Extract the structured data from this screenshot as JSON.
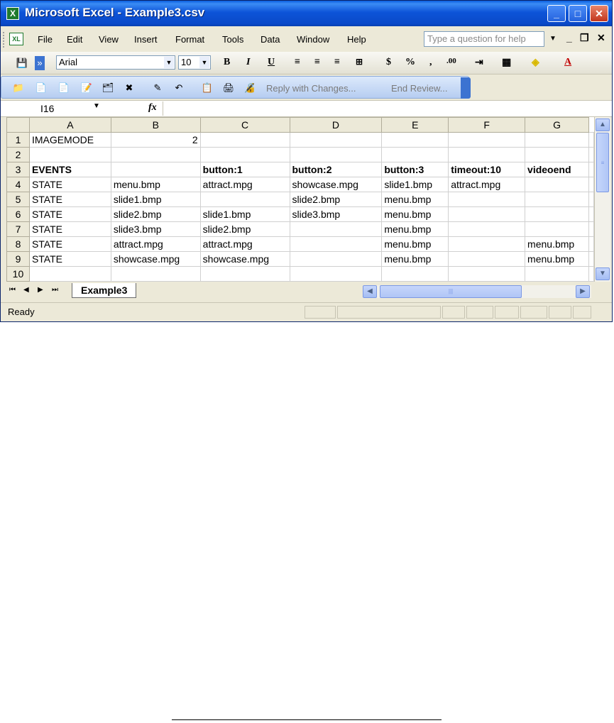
{
  "window": {
    "title": "Microsoft Excel - Example3.csv"
  },
  "menubar": {
    "items": [
      "File",
      "Edit",
      "View",
      "Insert",
      "Format",
      "Tools",
      "Data",
      "Window",
      "Help"
    ],
    "help_placeholder": "Type a question for help"
  },
  "formatting": {
    "font": "Arial",
    "size": "10",
    "bold": "B",
    "italic": "I",
    "underline": "U",
    "currency": "$",
    "percent": "%",
    "comma": ",",
    "decimal": ".00"
  },
  "reviewing": {
    "reply": "Reply with Changes...",
    "end": "End Review..."
  },
  "formula_bar": {
    "name_box": "I16",
    "fx": "fx",
    "value": ""
  },
  "sheet": {
    "columns": [
      "A",
      "B",
      "C",
      "D",
      "E",
      "F",
      "G"
    ],
    "rows": [
      {
        "n": "1",
        "cells": [
          "IMAGEMODE",
          "2",
          "",
          "",
          "",
          "",
          ""
        ]
      },
      {
        "n": "2",
        "cells": [
          "",
          "",
          "",
          "",
          "",
          "",
          ""
        ]
      },
      {
        "n": "3",
        "cells": [
          "EVENTS",
          "",
          "button:1",
          "button:2",
          "button:3",
          "timeout:10",
          "videoend"
        ]
      },
      {
        "n": "4",
        "cells": [
          "STATE",
          "menu.bmp",
          "attract.mpg",
          "showcase.mpg",
          "slide1.bmp",
          "attract.mpg",
          ""
        ]
      },
      {
        "n": "5",
        "cells": [
          "STATE",
          "slide1.bmp",
          "",
          "slide2.bmp",
          "menu.bmp",
          "",
          ""
        ]
      },
      {
        "n": "6",
        "cells": [
          "STATE",
          "slide2.bmp",
          "slide1.bmp",
          "slide3.bmp",
          "menu.bmp",
          "",
          ""
        ]
      },
      {
        "n": "7",
        "cells": [
          "STATE",
          "slide3.bmp",
          "slide2.bmp",
          "",
          "menu.bmp",
          "",
          ""
        ]
      },
      {
        "n": "8",
        "cells": [
          "STATE",
          "attract.mpg",
          "attract.mpg",
          "",
          "menu.bmp",
          "",
          "menu.bmp"
        ]
      },
      {
        "n": "9",
        "cells": [
          "STATE",
          "showcase.mpg",
          "showcase.mpg",
          "",
          "menu.bmp",
          "",
          "menu.bmp"
        ]
      },
      {
        "n": "10",
        "cells": [
          "",
          "",
          "",
          "",
          "",
          "",
          ""
        ]
      }
    ],
    "tab": "Example3"
  },
  "status": {
    "text": "Ready"
  }
}
